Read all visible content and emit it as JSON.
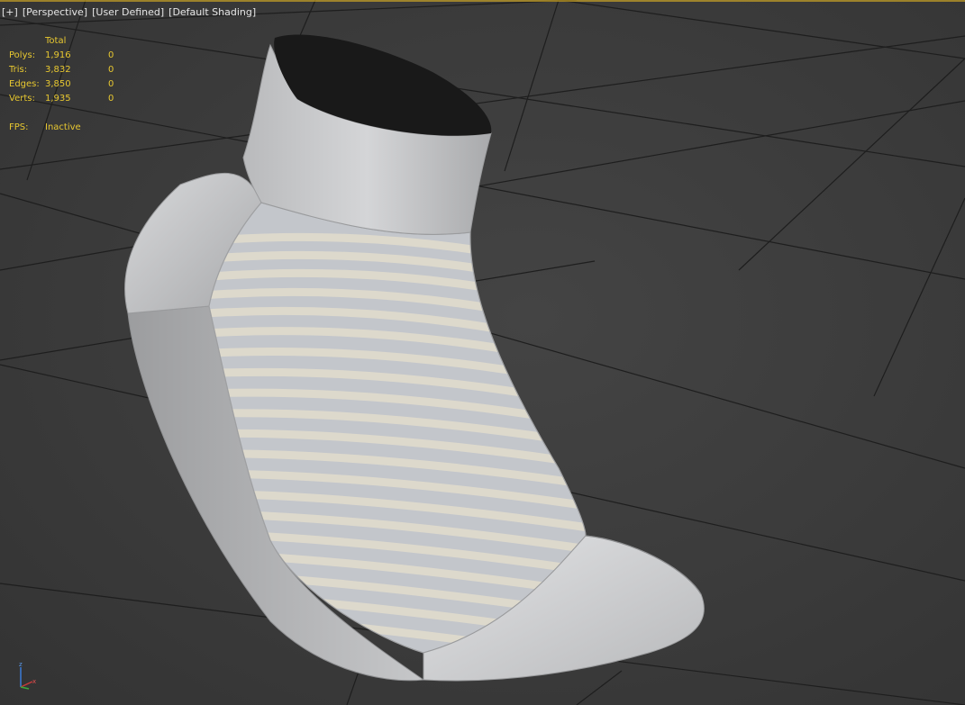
{
  "viewport": {
    "labels": [
      "[+]",
      "[Perspective]",
      "[User Defined]",
      "[Default Shading]"
    ]
  },
  "stats": {
    "header": "Total",
    "rows": [
      {
        "key": "Polys:",
        "value": "1,916",
        "selected": "0"
      },
      {
        "key": "Tris:",
        "value": "3,832",
        "selected": "0"
      },
      {
        "key": "Edges:",
        "value": "3,850",
        "selected": "0"
      },
      {
        "key": "Verts:",
        "value": "1,935",
        "selected": "0"
      }
    ],
    "fps_label": "FPS:",
    "fps_value": "Inactive"
  },
  "gizmo": {
    "axes": [
      "z",
      "x"
    ]
  },
  "colors": {
    "background": "#3a3a3a",
    "grid": "#1f1f1f",
    "stats_text": "#e8c830",
    "label_text": "#e6e6e6",
    "sock_base": "#c9cacc",
    "sock_stripe": "#dcd8cc",
    "sock_opening": "#1a1a1a"
  },
  "model": {
    "name": "sock",
    "icon": "sock-model"
  }
}
